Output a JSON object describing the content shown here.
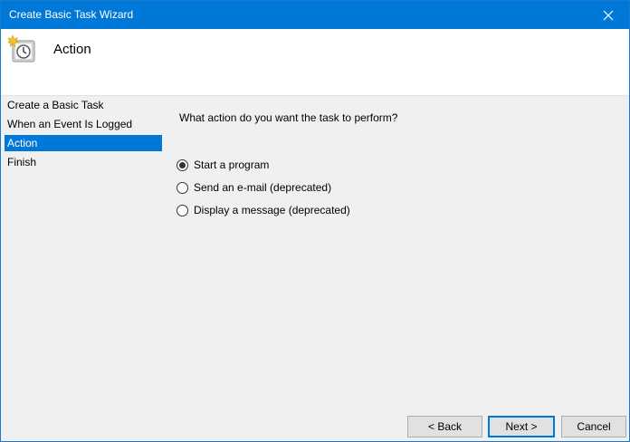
{
  "window": {
    "title": "Create Basic Task Wizard"
  },
  "header": {
    "title": "Action",
    "icon": "task-scheduler-clock-icon"
  },
  "sidebar": {
    "items": [
      {
        "label": "Create a Basic Task",
        "active": false
      },
      {
        "label": "When an Event Is Logged",
        "active": false
      },
      {
        "label": "Action",
        "active": true
      },
      {
        "label": "Finish",
        "active": false
      }
    ]
  },
  "main": {
    "question": "What action do you want the task to perform?",
    "options": [
      {
        "label": "Start a program",
        "selected": true
      },
      {
        "label": "Send an e-mail (deprecated)",
        "selected": false
      },
      {
        "label": "Display a message (deprecated)",
        "selected": false
      }
    ]
  },
  "buttons": {
    "back": "< Back",
    "next": "Next >",
    "cancel": "Cancel"
  },
  "colors": {
    "accent": "#0078d7",
    "background": "#f0f0f0",
    "header_background": "#ffffff"
  }
}
